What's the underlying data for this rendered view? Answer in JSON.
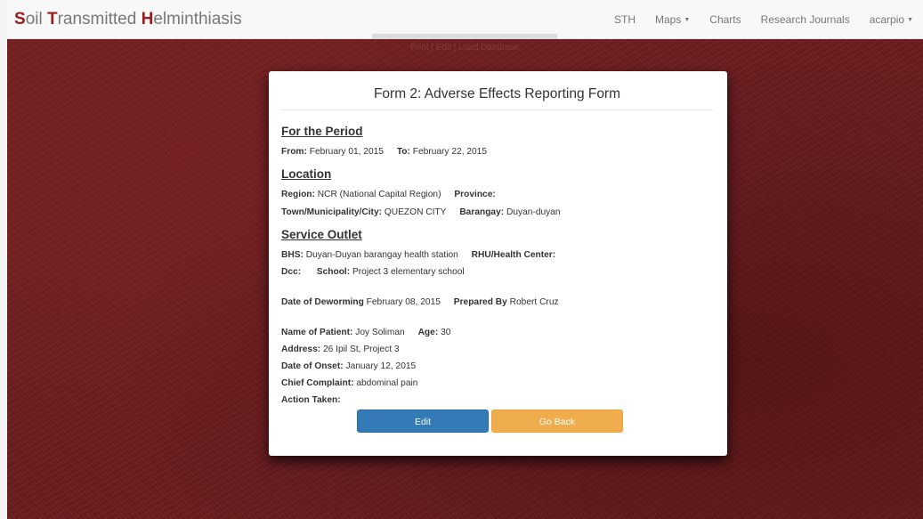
{
  "brand": {
    "s": "S",
    "oil": "oil ",
    "t": "T",
    "ransmitted": "ransmitted ",
    "h": "H",
    "elminthiasis": "elminthiasis"
  },
  "nav": {
    "sth": "STH",
    "maps": "Maps",
    "charts": "Charts",
    "journals": "Research Journals",
    "user": "acarpio"
  },
  "subbar": {
    "text": "Print | Edit | Load Database"
  },
  "form": {
    "title": "Form 2: Adverse Effects Reporting Form",
    "period": {
      "heading": "For the Period",
      "from_label": "From:",
      "from_value": "February 01, 2015",
      "to_label": "To:",
      "to_value": "February 22, 2015"
    },
    "location": {
      "heading": "Location",
      "region_label": "Region:",
      "region_value": "NCR (National Capital Region)",
      "province_label": "Province:",
      "province_value": "",
      "town_label": "Town/Municipality/City:",
      "town_value": "QUEZON CITY",
      "barangay_label": "Barangay:",
      "barangay_value": "Duyan-duyan"
    },
    "outlet": {
      "heading": "Service Outlet",
      "bhs_label": "BHS:",
      "bhs_value": "Duyan-Duyan barangay health station",
      "rhu_label": "RHU/Health Center:",
      "rhu_value": "",
      "dcc_label": "Dcc:",
      "dcc_value": "",
      "school_label": "School:",
      "school_value": "Project 3 elementary school"
    },
    "deworming": {
      "date_label": "Date of Deworming",
      "date_value": "February 08, 2015",
      "prepared_label": "Prepared By",
      "prepared_value": "Robert Cruz"
    },
    "patient": {
      "name_label": "Name of Patient:",
      "name_value": "Joy Soliman",
      "age_label": "Age:",
      "age_value": "30",
      "address_label": "Address:",
      "address_value": "26 Ipil St, Project 3",
      "onset_label": "Date of Onset:",
      "onset_value": "January 12, 2015",
      "complaint_label": "Chief Complaint:",
      "complaint_value": "abdominal pain",
      "action_label": "Action Taken:",
      "action_value": ""
    },
    "buttons": {
      "edit": "Edit",
      "back": "Go Back"
    }
  },
  "colors": {
    "brand_accent": "#9b1b1b",
    "edit": "#337ab7",
    "back": "#f0ad4e",
    "background": "#6b1c1e"
  }
}
